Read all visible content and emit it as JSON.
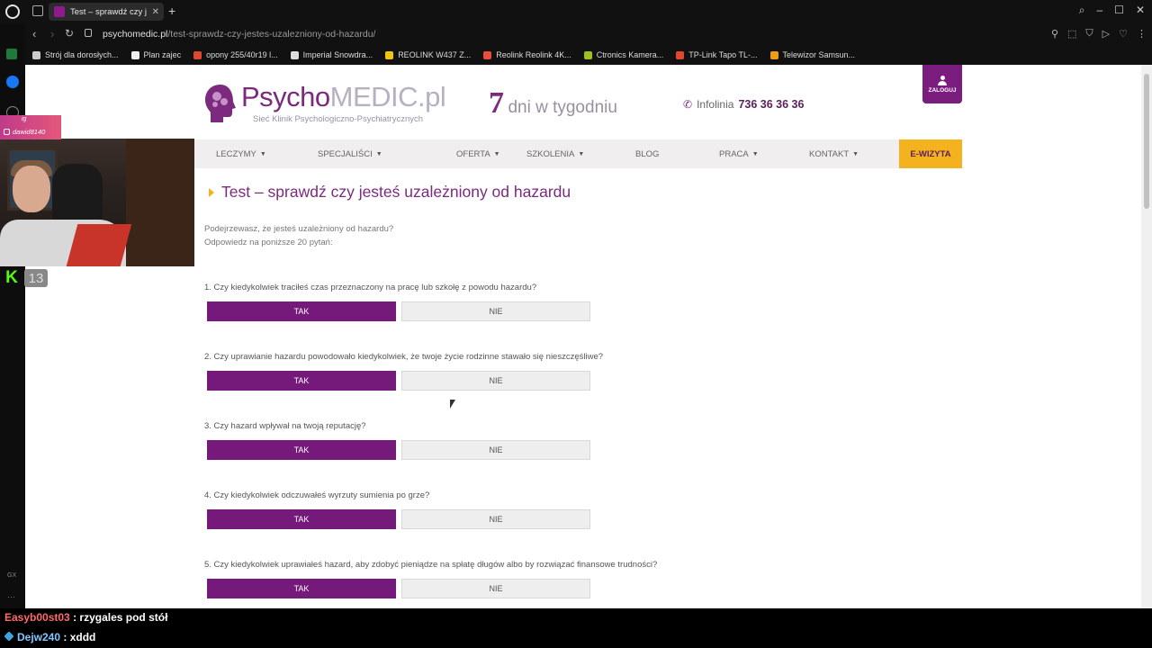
{
  "browser": {
    "tab_title": "Test – sprawdź czy jesteś",
    "url_domain": "psychomedic.pl",
    "url_path": "/test-sprawdz-czy-jestes-uzalezniony-od-hazardu/",
    "bookmarks": [
      {
        "label": "Strój dla dorosłych...",
        "color": "#cccccc"
      },
      {
        "label": "Plan zajec",
        "color": "#eeeeee"
      },
      {
        "label": "opony 255/40r19 l...",
        "color": "#e0482e"
      },
      {
        "label": "Imperial Snowdra...",
        "color": "#dddddd"
      },
      {
        "label": "REOLINK W437 Z...",
        "color": "#f1c40f"
      },
      {
        "label": "Reolink Reolink 4K...",
        "color": "#e74c3c"
      },
      {
        "label": "Ctronics Kamera...",
        "color": "#a0c020"
      },
      {
        "label": "TP-Link Tapo TL-...",
        "color": "#e0482e"
      },
      {
        "label": "Telewizor Samsun...",
        "color": "#f39c12"
      }
    ]
  },
  "header": {
    "brand_dark": "Psycho",
    "brand_light": "MEDIC.pl",
    "tagline": "Sieć Klinik Psychologiczno-Psychiatrycznych",
    "days_num": "7",
    "days_text": "dni w tygodniu",
    "info_label": "Infolinia",
    "info_number": "736 36 36 36",
    "login_label": "ZALOGUJ"
  },
  "nav": {
    "items": [
      "LECZYMY",
      "SPECJALIŚCI",
      "OFERTA",
      "SZKOLENIA",
      "BLOG",
      "PRACA",
      "KONTAKT"
    ],
    "cta": "E-WIZYTA"
  },
  "content": {
    "title": "Test – sprawdź czy jesteś uzależniony od hazardu",
    "intro1": "Podejrzewasz, że jesteś uzależniony od hazardu?",
    "intro2": "Odpowiedz na poniższe 20 pytań:",
    "yes_label": "TAK",
    "no_label": "NIE",
    "questions": [
      "1. Czy kiedykolwiek traciłeś czas przeznaczony na pracę lub szkołę z powodu hazardu?",
      "2. Czy uprawianie hazardu powodowało kiedykolwiek, że twoje życie rodzinne stawało się nieszczęśliwe?",
      "3. Czy hazard wpływał na twoją reputację?",
      "4. Czy kiedykolwiek odczuwałeś wyrzuty sumienia po grze?",
      "5. Czy kiedykolwiek uprawiałeś hazard, aby zdobyć pieniądze na spłatę długów albo by rozwiązać finansowe trudności?"
    ]
  },
  "stream": {
    "ig_label": "ig",
    "ig_user": "dawid8140",
    "kick_logo": "K",
    "viewer_count": "13",
    "chat": [
      {
        "user": "Easyb00st03",
        "color": "#ff6a6a",
        "text": " : rzygales pod stół"
      },
      {
        "user": "Dejw240",
        "color": "#7ec8ff",
        "text": " : xddd"
      }
    ]
  }
}
